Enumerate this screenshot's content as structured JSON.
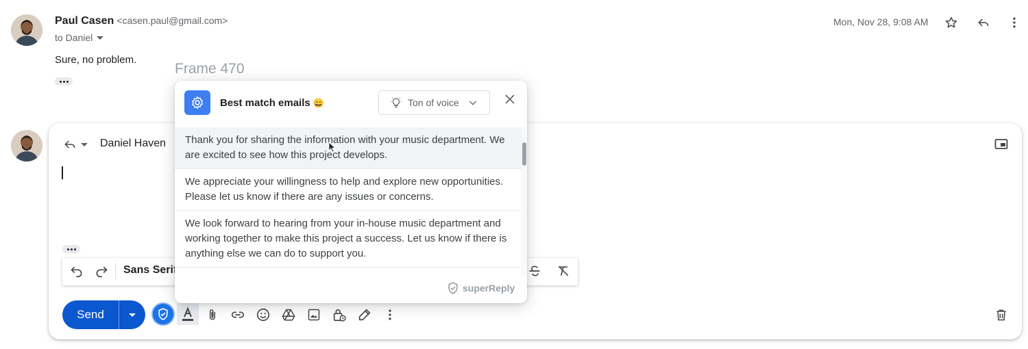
{
  "message": {
    "sender_name": "Paul Casen",
    "sender_email": "<casen.paul@gmail.com>",
    "to_line": "to Daniel",
    "date": "Mon, Nov 28, 9:08 AM",
    "body": "Sure, no problem."
  },
  "overlay_label": "Frame 470",
  "reply": {
    "recipient": "Daniel Haven",
    "font_name": "Sans Serif",
    "send_label": "Send"
  },
  "superreply": {
    "title": "Best match emails",
    "title_emoji": "😄",
    "tone_label": "Ton of voice",
    "suggestions": [
      "Thank you for sharing the information with your music department. We are excited to see how this project develops.",
      "We appreciate your willingness to help and explore new opportunities. Please let us know if there are any issues or concerns.",
      "We look forward to hearing from your in-house music department and working together to make this project a success. Let us know if there is anything else we can do to support you.",
      "We look forward to hearing from your in-house music department and"
    ],
    "brand": "superReply"
  },
  "colors": {
    "accent_blue": "#0b57d0",
    "superreply_blue": "#3d7ef2"
  },
  "icons": [
    "star-icon",
    "reply-icon",
    "more-vert-icon",
    "undo-icon",
    "redo-icon",
    "strikethrough-icon",
    "clear-format-icon",
    "pop-out-icon",
    "text-color-icon",
    "attach-icon",
    "link-icon",
    "emoji-icon",
    "drive-icon",
    "photo-icon",
    "lock-clock-icon",
    "signature-icon",
    "trash-icon",
    "gear-icon",
    "lightbulb-icon",
    "close-icon"
  ]
}
